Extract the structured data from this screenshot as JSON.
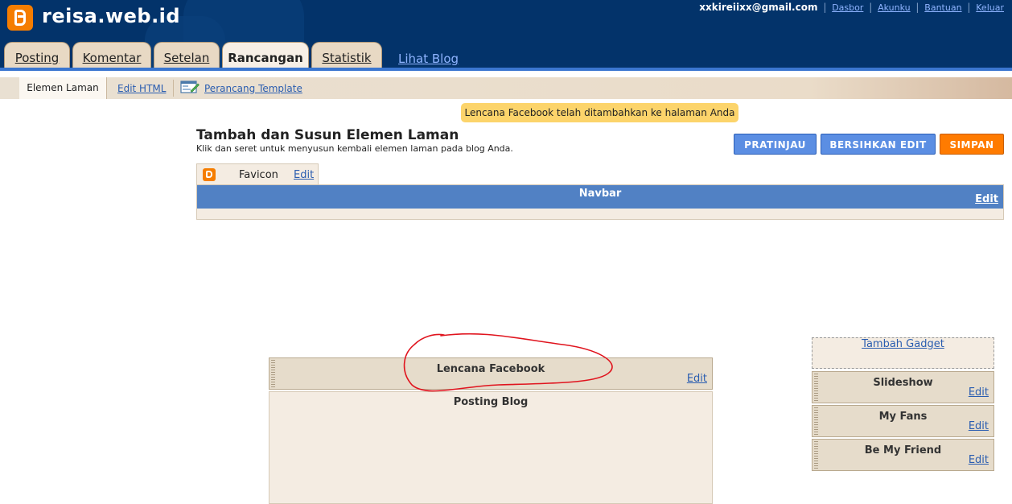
{
  "header": {
    "site_title": "reisa.web.id",
    "email": "xxkireiixx@gmail.com",
    "links": [
      "Dasbor",
      "Akunku",
      "Bantuan",
      "Keluar"
    ],
    "separator": "|"
  },
  "tabs": [
    {
      "label": "Posting",
      "active": false
    },
    {
      "label": "Komentar",
      "active": false
    },
    {
      "label": "Setelan",
      "active": false
    },
    {
      "label": "Rancangan",
      "active": true
    },
    {
      "label": "Statistik",
      "active": false
    }
  ],
  "view_blog_label": "Lihat Blog",
  "subnav": {
    "active_label": "Elemen Laman",
    "edit_html_label": "Edit HTML",
    "template_designer_label": "Perancang Template"
  },
  "notice": "Lencana Facebook telah ditambahkan ke halaman Anda",
  "page": {
    "title": "Tambah dan Susun Elemen Laman",
    "subtitle": "Klik dan seret untuk menyusun kembali elemen laman pada blog Anda."
  },
  "buttons": {
    "preview": "PRATINJAU",
    "clear": "BERSIHKAN EDIT",
    "save": "SIMPAN"
  },
  "favicon": {
    "label": "Favicon",
    "edit": "Edit"
  },
  "navbar": {
    "label": "Navbar",
    "edit": "Edit"
  },
  "main": {
    "fb_gadget": {
      "label": "Lencana Facebook",
      "edit": "Edit"
    },
    "posting_label": "Posting Blog"
  },
  "sidebar": {
    "add_gadget": "Tambah Gadget",
    "gadgets": [
      {
        "label": "Slideshow",
        "edit": "Edit"
      },
      {
        "label": "My Fans",
        "edit": "Edit"
      },
      {
        "label": "Be My Friend",
        "edit": "Edit"
      }
    ]
  },
  "colors": {
    "header_bg": "#03336a",
    "accent_blue": "#5b8ee3",
    "save_orange": "#ff7b00",
    "notice_yellow": "#fcd46b",
    "annotation_red": "#e0141e"
  }
}
